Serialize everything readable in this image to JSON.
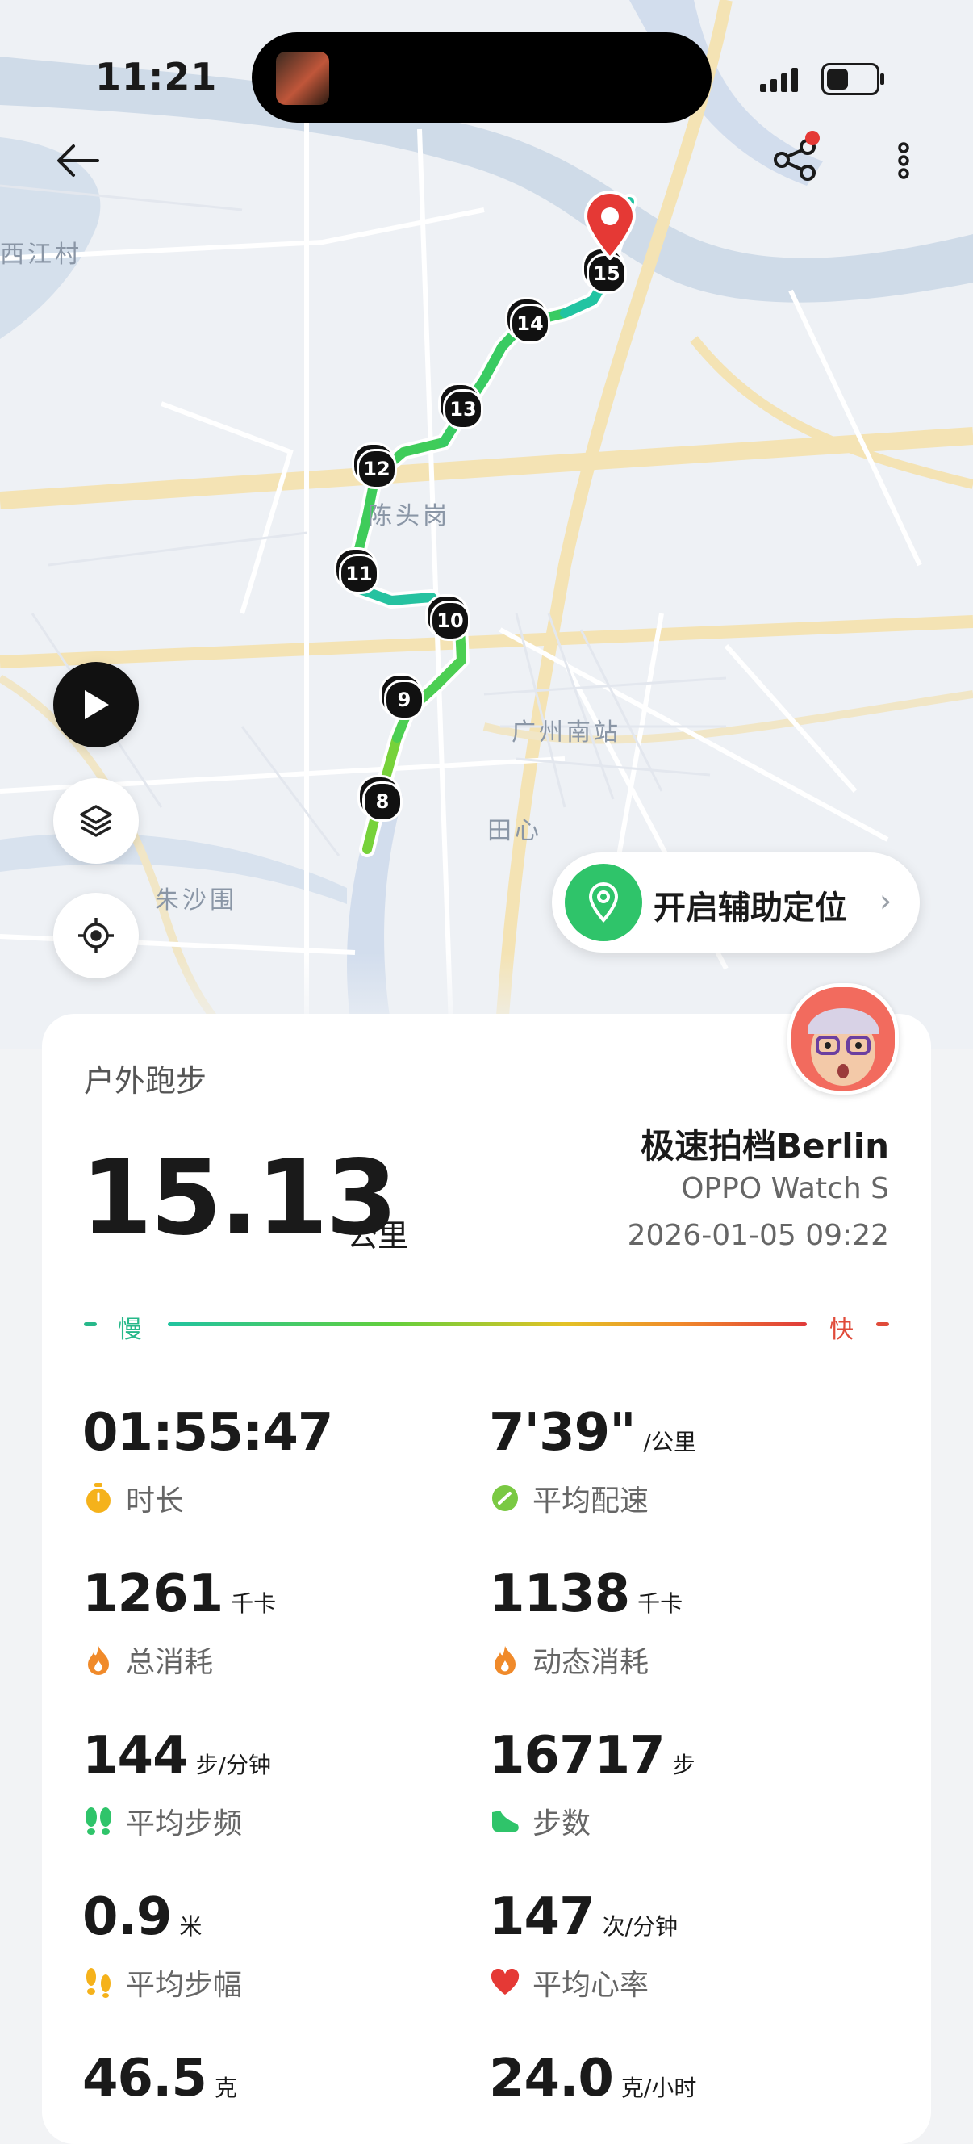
{
  "status_bar": {
    "time": "11:21"
  },
  "map": {
    "labels": [
      "西江村",
      "陈头岗",
      "广州南站",
      "田心",
      "朱沙围"
    ],
    "route_markers": [
      "8",
      "9",
      "10",
      "11",
      "12",
      "13",
      "14",
      "15"
    ],
    "assist_location_label": "开启辅助定位"
  },
  "workout": {
    "sport_type": "户外跑步",
    "distance": "15.13",
    "distance_unit": "公里",
    "partner": "极速拍档Berlin",
    "device": "OPPO Watch S",
    "datetime": "2026-01-05 09:22",
    "pace_slow_label": "慢",
    "pace_fast_label": "快"
  },
  "stats": [
    {
      "value": "01:55:47",
      "unit": "",
      "label": "时长",
      "icon": "timer-icon",
      "color": "#f5b21b"
    },
    {
      "value": "7'39\"",
      "unit": "/公里",
      "label": "平均配速",
      "icon": "pace-icon",
      "color": "#7ac943"
    },
    {
      "value": "1261",
      "unit": "千卡",
      "label": "总消耗",
      "icon": "flame-icon",
      "color": "#f08a2a"
    },
    {
      "value": "1138",
      "unit": "千卡",
      "label": "动态消耗",
      "icon": "flame-icon",
      "color": "#f08a2a"
    },
    {
      "value": "144",
      "unit": "步/分钟",
      "label": "平均步频",
      "icon": "footprints-icon",
      "color": "#2fc46a"
    },
    {
      "value": "16717",
      "unit": "步",
      "label": "步数",
      "icon": "shoe-icon",
      "color": "#2fc46a"
    },
    {
      "value": "0.9",
      "unit": "米",
      "label": "平均步幅",
      "icon": "stride-icon",
      "color": "#f5b21b"
    },
    {
      "value": "147",
      "unit": "次/分钟",
      "label": "平均心率",
      "icon": "heart-icon",
      "color": "#e53935"
    },
    {
      "value": "46.5",
      "unit": "克",
      "label": "",
      "icon": "",
      "color": ""
    },
    {
      "value": "24.0",
      "unit": "克/小时",
      "label": "",
      "icon": "",
      "color": ""
    }
  ]
}
